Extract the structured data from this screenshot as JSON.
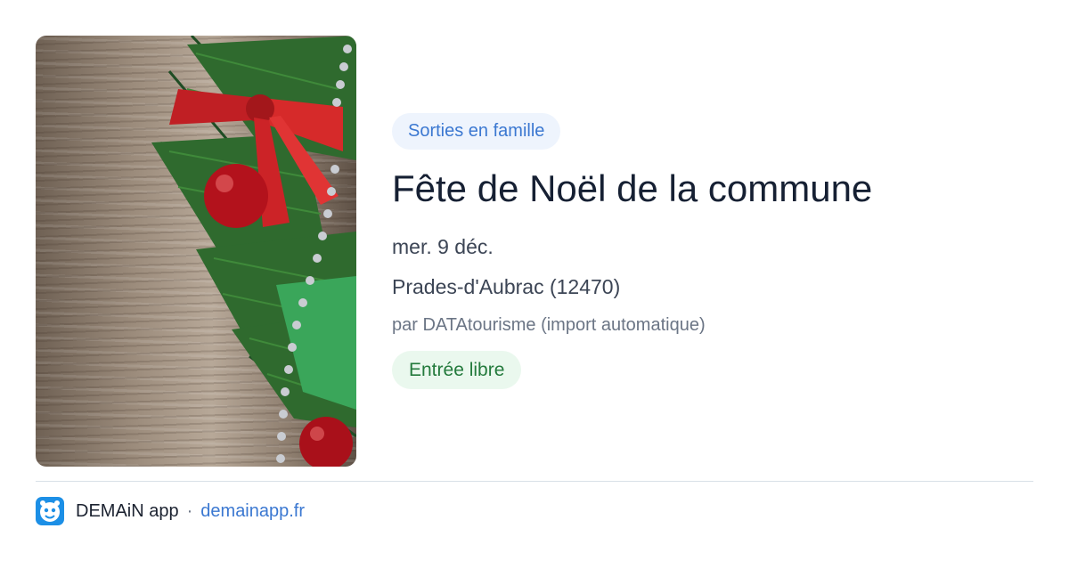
{
  "event": {
    "image_alt": "Décoration de Noël sur bois",
    "category": "Sorties en famille",
    "title": "Fête de Noël de la commune",
    "date": "mer. 9 déc.",
    "location": "Prades-d'Aubrac (12470)",
    "author": "par DATAtourisme (import automatique)",
    "price": "Entrée libre"
  },
  "footer": {
    "app_name": "DEMAiN app",
    "separator": "·",
    "url": "demainapp.fr",
    "icon": "app-logo-icon"
  },
  "colors": {
    "category_bg": "#eef4fd",
    "category_text": "#3b78d1",
    "title_text": "#162033",
    "price_bg": "#eaf8ee",
    "price_text": "#237a3c",
    "link": "#3b78d1",
    "app_icon_bg": "#1c8fe6"
  }
}
